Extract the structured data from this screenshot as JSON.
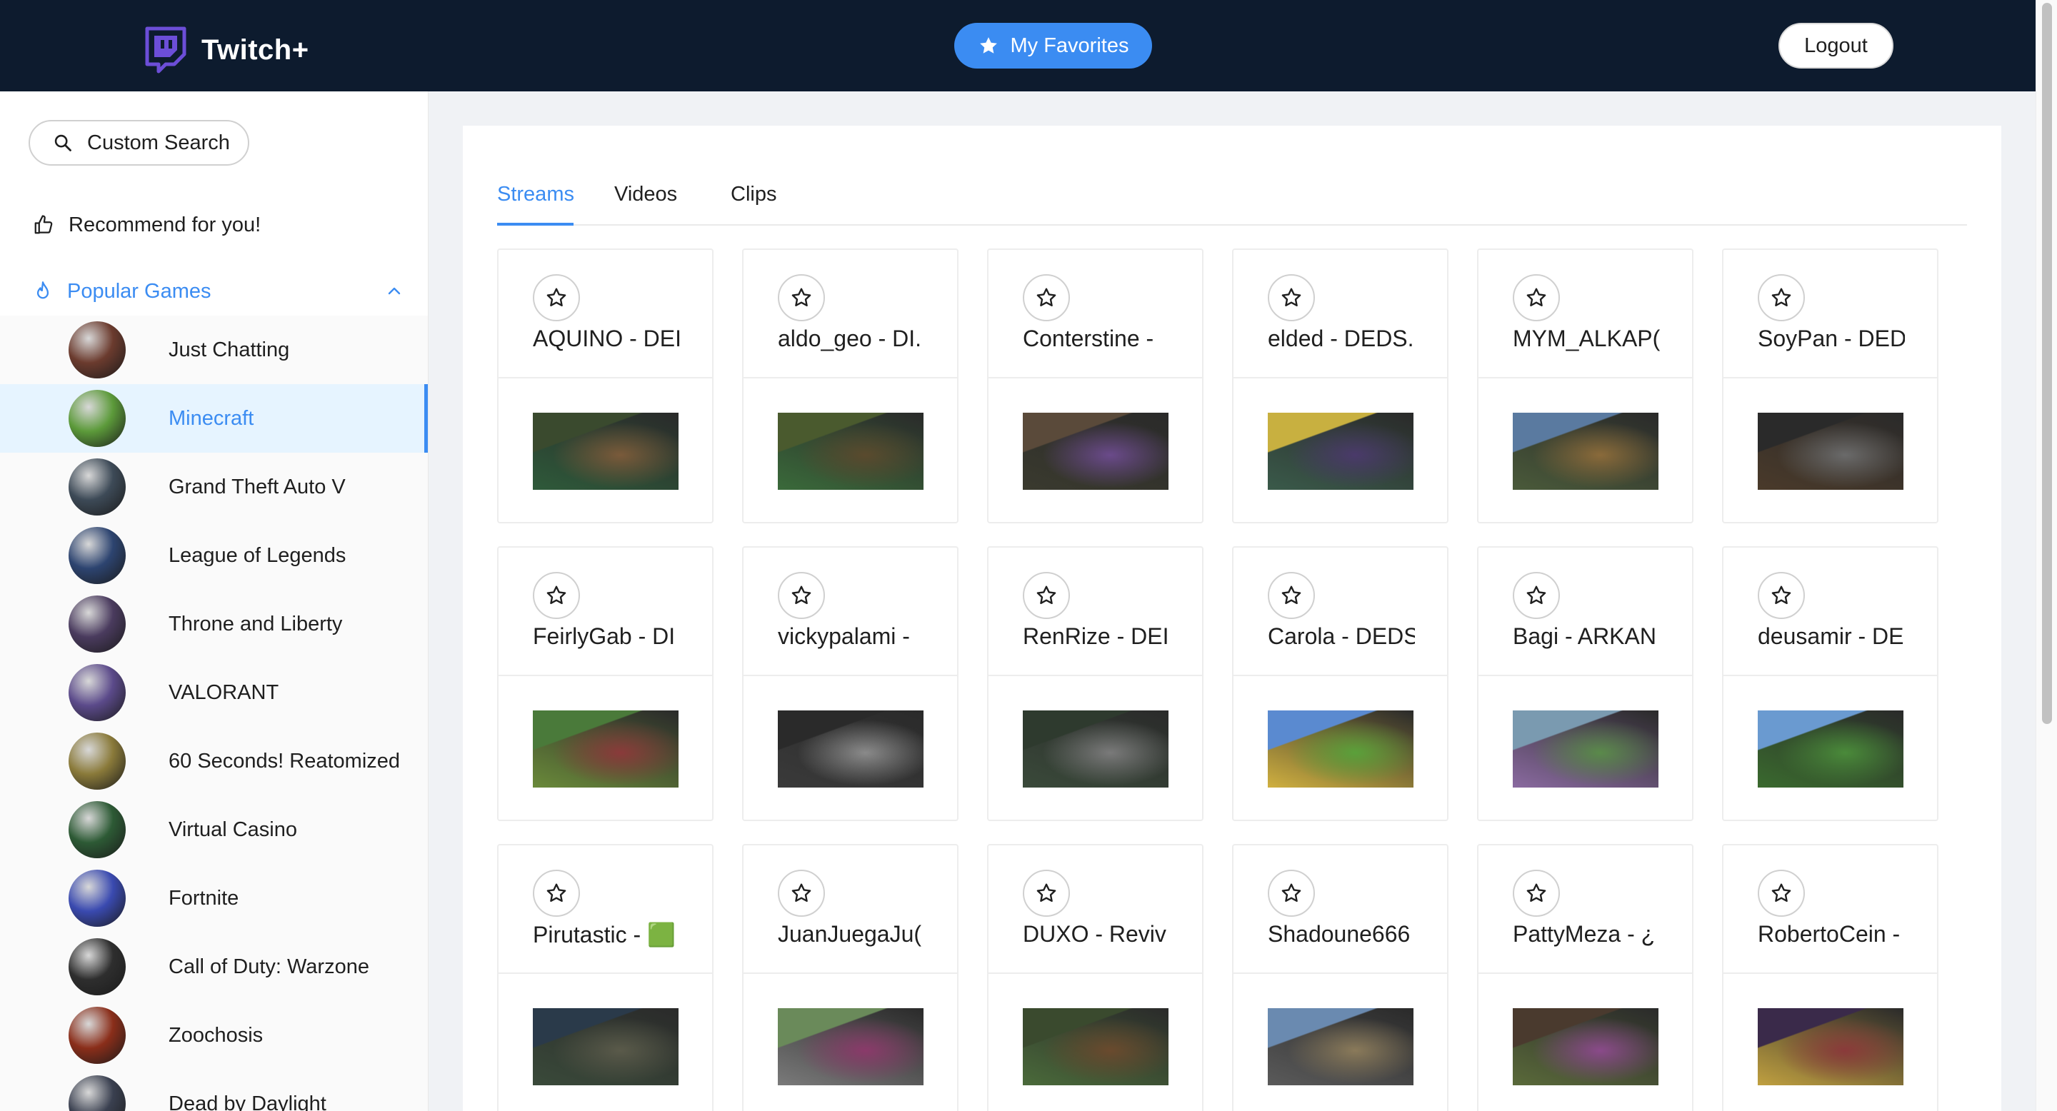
{
  "app": {
    "name": "Twitch+"
  },
  "header": {
    "favorites_label": "My Favorites",
    "logout_label": "Logout"
  },
  "sidebar": {
    "search_label": "Custom Search",
    "recommend_label": "Recommend for you!",
    "popular_label": "Popular Games",
    "games": [
      {
        "name": "Just Chatting",
        "color": "#6b3b2e"
      },
      {
        "name": "Minecraft",
        "color": "#5c9a3a"
      },
      {
        "name": "Grand Theft Auto V",
        "color": "#3d4a57"
      },
      {
        "name": "League of Legends",
        "color": "#2d4470"
      },
      {
        "name": "Throne and Liberty",
        "color": "#4a3b5e"
      },
      {
        "name": "VALORANT",
        "color": "#5b4a8a"
      },
      {
        "name": "60 Seconds! Reatomized",
        "color": "#8a7a3a"
      },
      {
        "name": "Virtual Casino",
        "color": "#2d5a35"
      },
      {
        "name": "Fortnite",
        "color": "#3a4ab0"
      },
      {
        "name": "Call of Duty: Warzone",
        "color": "#2e2e2e"
      },
      {
        "name": "Zoochosis",
        "color": "#8a2e1a"
      },
      {
        "name": "Dead by Daylight",
        "color": "#3a4050"
      }
    ],
    "active_game": "Minecraft"
  },
  "tabs": [
    "Streams",
    "Videos",
    "Clips"
  ],
  "streams": [
    {
      "title": "AQUINO - DEI",
      "thumb": [
        "#3a4a2e",
        "#7a5a3a",
        "#2e5a3a"
      ]
    },
    {
      "title": "aldo_geo - DI.",
      "thumb": [
        "#4a5a2e",
        "#5a4a2e",
        "#3a6a3a"
      ]
    },
    {
      "title": "Conterstine -",
      "thumb": [
        "#5a4a3a",
        "#6a4a8a",
        "#3a3a2e"
      ]
    },
    {
      "title": "elded - DEDS.",
      "thumb": [
        "#c8b040",
        "#4a3a6a",
        "#3a5a4a"
      ]
    },
    {
      "title": "MYM_ALKAP(",
      "thumb": [
        "#5a7aa0",
        "#8a6a3a",
        "#4a5a3a"
      ]
    },
    {
      "title": "SoyPan - DED",
      "thumb": [
        "#2a2a2a",
        "#6a6a6a",
        "#4a3a2a"
      ]
    },
    {
      "title": "FeirlyGab - DI",
      "thumb": [
        "#4a7a3a",
        "#8a3a3a",
        "#6a8a3a"
      ]
    },
    {
      "title": "vickypalami -",
      "thumb": [
        "#2a2a2a",
        "#8a8a8a",
        "#3a3a3a"
      ]
    },
    {
      "title": "RenRize - DEI",
      "thumb": [
        "#2e3a2e",
        "#7a7a7a",
        "#3a4a3a"
      ]
    },
    {
      "title": "Carola - DEDS",
      "thumb": [
        "#5a8ad0",
        "#5aa03a",
        "#d0b040"
      ]
    },
    {
      "title": "Bagi - ARKAN",
      "thumb": [
        "#7a9ab0",
        "#5a8a4a",
        "#8a6aa0"
      ]
    },
    {
      "title": "deusamir - DE",
      "thumb": [
        "#6a9ad0",
        "#4a8a3a",
        "#3a6a2e"
      ]
    },
    {
      "title": "Pirutastic - 🟩",
      "thumb": [
        "#2a3a4a",
        "#5a5a4a",
        "#3a4a3a"
      ]
    },
    {
      "title": "JuanJuegaJu(",
      "thumb": [
        "#6a8a5a",
        "#8a3a6a",
        "#7a7a7a"
      ]
    },
    {
      "title": "DUXO - Reviv",
      "thumb": [
        "#3a4a2e",
        "#6a4a2e",
        "#4a6a3a"
      ]
    },
    {
      "title": "Shadoune666",
      "thumb": [
        "#6a8ab0",
        "#8a7a5a",
        "#5a5a5a"
      ]
    },
    {
      "title": "PattyMeza - ¿",
      "thumb": [
        "#4a3a2e",
        "#8a4a8a",
        "#5a6a3a"
      ]
    },
    {
      "title": "RobertoCein -",
      "thumb": [
        "#3a2a4a",
        "#8a3a3a",
        "#c0a040"
      ]
    }
  ]
}
